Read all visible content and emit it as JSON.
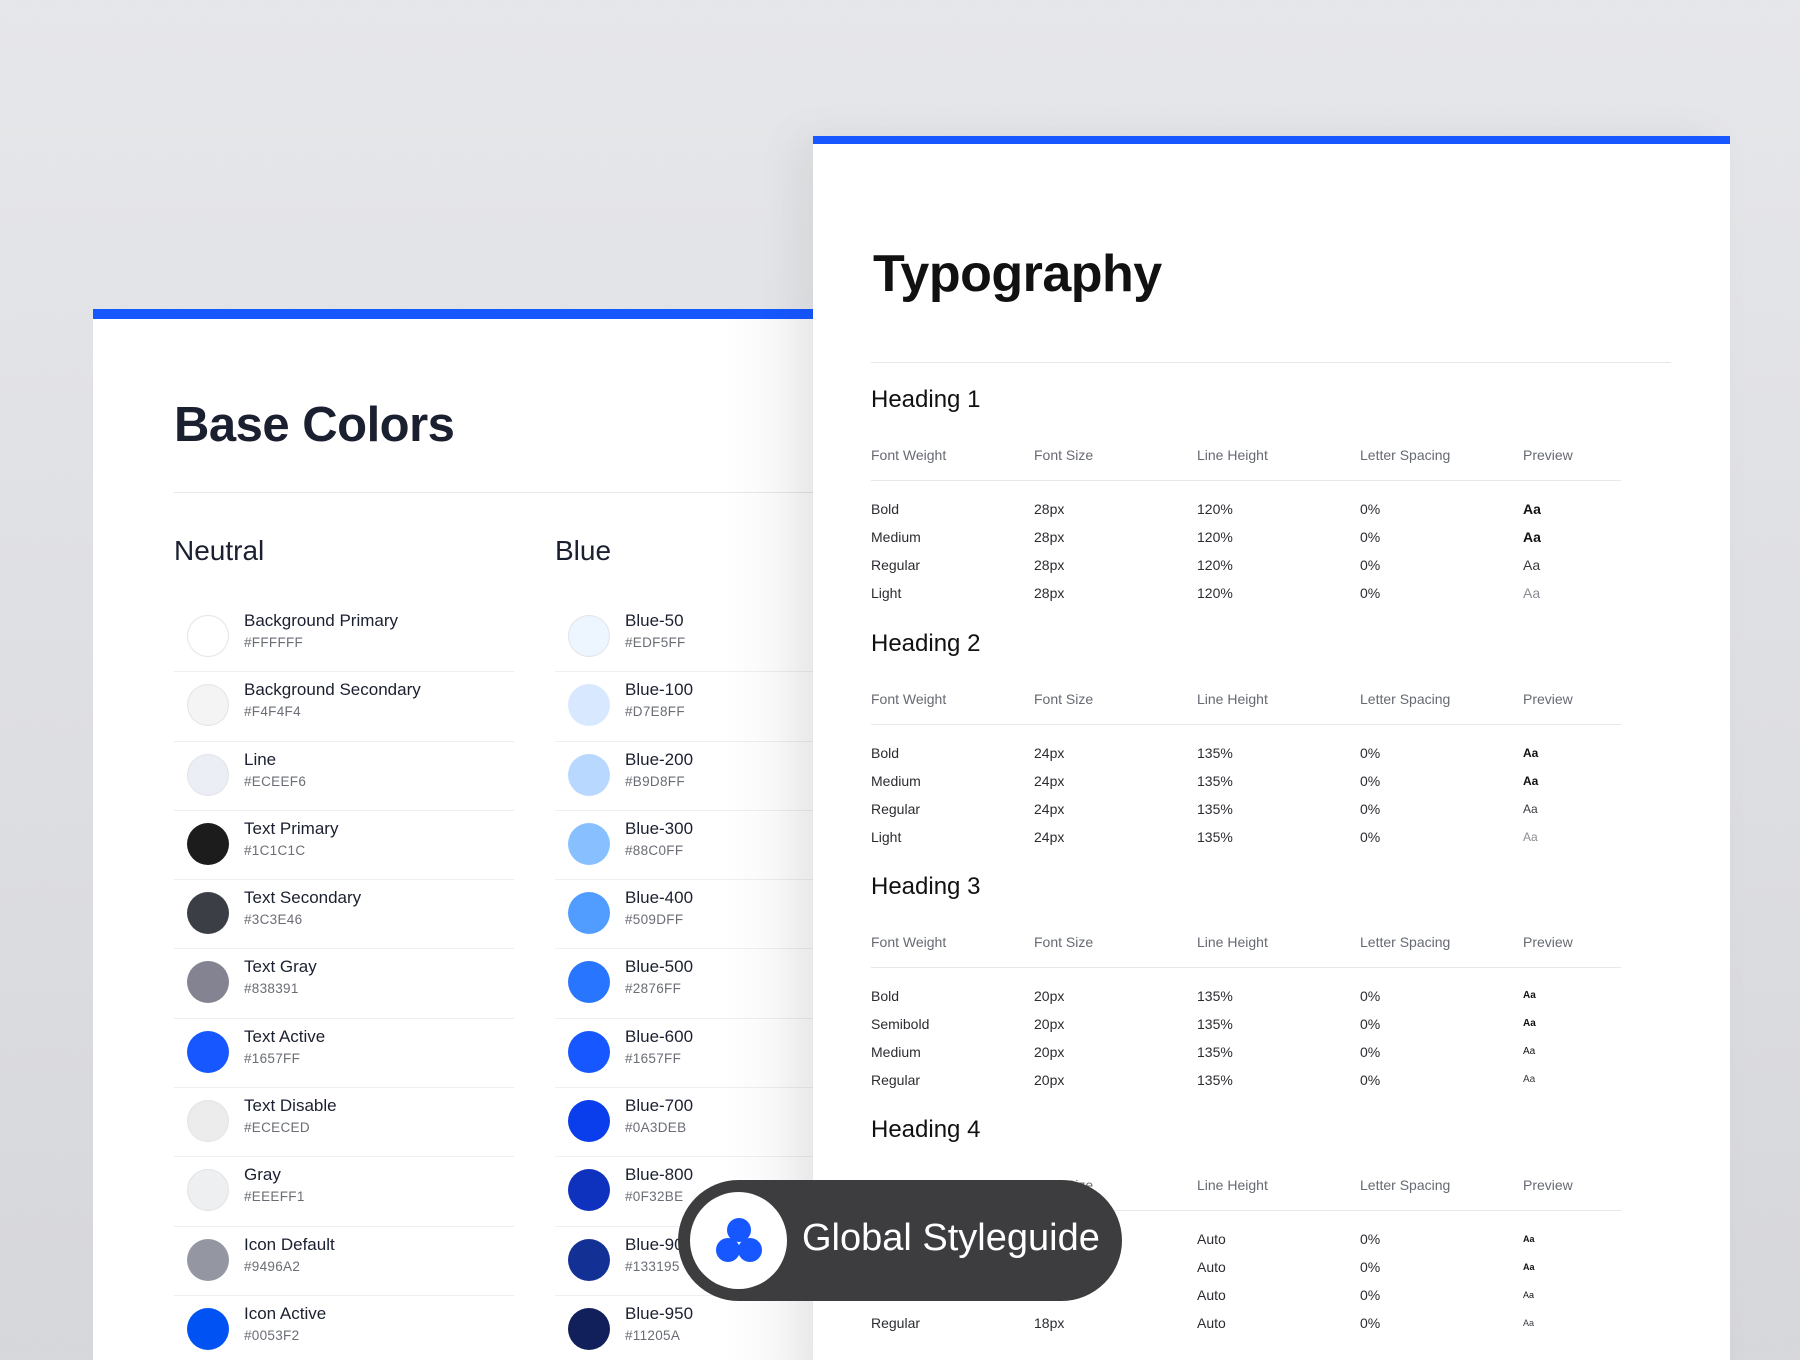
{
  "base_colors": {
    "title": "Base Colors",
    "neutral": {
      "title": "Neutral",
      "items": [
        {
          "name": "Background Primary",
          "hex": "#FFFFFF",
          "light": true
        },
        {
          "name": "Background Secondary",
          "hex": "#F4F4F4",
          "light": true
        },
        {
          "name": "Line",
          "hex": "#ECEEF6",
          "light": true
        },
        {
          "name": "Text Primary",
          "hex": "#1C1C1C"
        },
        {
          "name": "Text Secondary",
          "hex": "#3C3E46"
        },
        {
          "name": "Text Gray",
          "hex": "#838391"
        },
        {
          "name": "Text Active",
          "hex": "#1657FF"
        },
        {
          "name": "Text Disable",
          "hex": "#ECECED",
          "light": true
        },
        {
          "name": "Gray",
          "hex": "#EEEFF1",
          "light": true
        },
        {
          "name": "Icon Default",
          "hex": "#9496A2"
        },
        {
          "name": "Icon Active",
          "hex": "#0053F2"
        }
      ]
    },
    "blue": {
      "title": "Blue",
      "items": [
        {
          "name": "Blue-50",
          "hex": "#EDF5FF",
          "light": true
        },
        {
          "name": "Blue-100",
          "hex": "#D7E8FF"
        },
        {
          "name": "Blue-200",
          "hex": "#B9D8FF"
        },
        {
          "name": "Blue-300",
          "hex": "#88C0FF"
        },
        {
          "name": "Blue-400",
          "hex": "#509DFF"
        },
        {
          "name": "Blue-500",
          "hex": "#2876FF"
        },
        {
          "name": "Blue-600",
          "hex": "#1657FF"
        },
        {
          "name": "Blue-700",
          "hex": "#0A3DEB"
        },
        {
          "name": "Blue-800",
          "hex": "#0F32BE"
        },
        {
          "name": "Blue-900",
          "hex": "#133195"
        },
        {
          "name": "Blue-950",
          "hex": "#11205A"
        }
      ]
    }
  },
  "typography": {
    "title": "Typography",
    "columns": [
      "Font Weight",
      "Font Size",
      "Line Height",
      "Letter Spacing",
      "Preview"
    ],
    "sections": [
      {
        "title": "Heading 1",
        "rows": [
          {
            "weight": "Bold",
            "size": "28px",
            "line_height": "120%",
            "spacing": "0%",
            "preview": "Aa",
            "fw": 700,
            "ps": 14
          },
          {
            "weight": "Medium",
            "size": "28px",
            "line_height": "120%",
            "spacing": "0%",
            "preview": "Aa",
            "fw": 600,
            "ps": 14
          },
          {
            "weight": "Regular",
            "size": "28px",
            "line_height": "120%",
            "spacing": "0%",
            "preview": "Aa",
            "fw": 400,
            "ps": 14
          },
          {
            "weight": "Light",
            "size": "28px",
            "line_height": "120%",
            "spacing": "0%",
            "preview": "Aa",
            "fw": 300,
            "ps": 14
          }
        ]
      },
      {
        "title": "Heading 2",
        "rows": [
          {
            "weight": "Bold",
            "size": "24px",
            "line_height": "135%",
            "spacing": "0%",
            "preview": "Aa",
            "fw": 700,
            "ps": 12
          },
          {
            "weight": "Medium",
            "size": "24px",
            "line_height": "135%",
            "spacing": "0%",
            "preview": "Aa",
            "fw": 600,
            "ps": 12
          },
          {
            "weight": "Regular",
            "size": "24px",
            "line_height": "135%",
            "spacing": "0%",
            "preview": "Aa",
            "fw": 400,
            "ps": 12
          },
          {
            "weight": "Light",
            "size": "24px",
            "line_height": "135%",
            "spacing": "0%",
            "preview": "Aa",
            "fw": 300,
            "ps": 12
          }
        ]
      },
      {
        "title": "Heading 3",
        "rows": [
          {
            "weight": "Bold",
            "size": "20px",
            "line_height": "135%",
            "spacing": "0%",
            "preview": "Aa",
            "fw": 700,
            "ps": 10
          },
          {
            "weight": "Semibold",
            "size": "20px",
            "line_height": "135%",
            "spacing": "0%",
            "preview": "Aa",
            "fw": 600,
            "ps": 10
          },
          {
            "weight": "Medium",
            "size": "20px",
            "line_height": "135%",
            "spacing": "0%",
            "preview": "Aa",
            "fw": 500,
            "ps": 10
          },
          {
            "weight": "Regular",
            "size": "20px",
            "line_height": "135%",
            "spacing": "0%",
            "preview": "Aa",
            "fw": 400,
            "ps": 10
          }
        ]
      },
      {
        "title": "Heading 4",
        "rows": [
          {
            "weight": "",
            "size": "",
            "line_height": "Auto",
            "spacing": "0%",
            "preview": "Aa",
            "fw": 700,
            "ps": 9
          },
          {
            "weight": "",
            "size": "",
            "line_height": "Auto",
            "spacing": "0%",
            "preview": "Aa",
            "fw": 600,
            "ps": 9
          },
          {
            "weight": "",
            "size": "",
            "line_height": "Auto",
            "spacing": "0%",
            "preview": "Aa",
            "fw": 500,
            "ps": 9
          },
          {
            "weight": "Regular",
            "size": "18px",
            "line_height": "Auto",
            "spacing": "0%",
            "preview": "Aa",
            "fw": 400,
            "ps": 9
          }
        ]
      }
    ]
  },
  "badge": {
    "label": "Global Styleguide",
    "icon": "styleguide-logo-icon",
    "logo_color": "#1657FF"
  },
  "colors": {
    "accent": "#1657FF",
    "badge_bg": "#3D3D3F"
  }
}
